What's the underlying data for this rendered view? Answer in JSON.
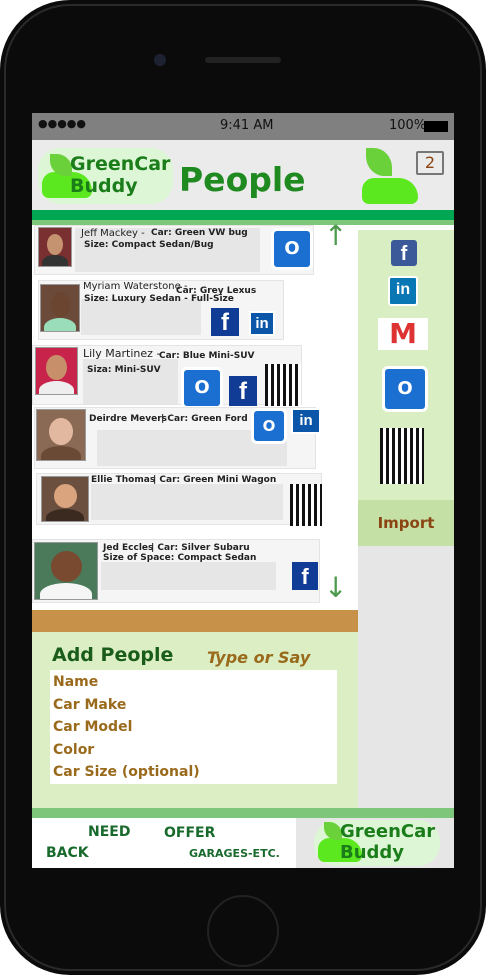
{
  "status_bar": {
    "signal": "●●●●●",
    "time": "9:41 AM",
    "battery": "100%"
  },
  "header": {
    "logo_line1": "GreenCar",
    "logo_line2": "Buddy",
    "title": "People",
    "notification_count": "2"
  },
  "people": [
    {
      "name": "Jeff Mackey -",
      "car": "Car: Green VW bug",
      "size": "Size: Compact Sedan/Bug",
      "icons": [
        "outlook"
      ]
    },
    {
      "name": "Myriam Waterstone -",
      "car": "Car: Grey Lexus",
      "size": "Size:  Luxury Sedan - Full-Size",
      "icons": [
        "facebook",
        "linkedin"
      ]
    },
    {
      "name": "Lily Martinez -",
      "car": "Car:  Blue Mini-SUV",
      "size": "Siza:  Mini-SUV",
      "icons": [
        "outlook",
        "facebook",
        "building"
      ]
    },
    {
      "name": "Deirdre Mevers",
      "car": "|  Car: Green Ford SUV",
      "size": "",
      "icons": [
        "outlook",
        "linkedin"
      ]
    },
    {
      "name": "Ellie Thomas",
      "car": "| Car: Green Mini Wagon",
      "size": "",
      "icons": [
        "building"
      ]
    },
    {
      "name": "Jed Eccles",
      "car": "|  Car: Silver Subaru",
      "size": "Size of Space: Compact Sedan",
      "icons": [
        "facebook"
      ]
    }
  ],
  "side_panel": {
    "icons": [
      "facebook",
      "linkedin",
      "gmail",
      "outlook",
      "building"
    ],
    "import_label": "Import"
  },
  "icon_glyphs": {
    "facebook": "f",
    "linkedin": "in",
    "outlook": "O",
    "gmail": "M"
  },
  "add_people": {
    "title": "Add People",
    "hint": "Type or Say",
    "fields": [
      "Name",
      "Car Make",
      "Car Model",
      "Color",
      "Car Size (optional)"
    ]
  },
  "bottom_nav": {
    "need": "NEED",
    "offer": "OFFER",
    "back": "BACK",
    "garages": "GARAGES-ETC.",
    "logo_line1": "GreenCar",
    "logo_line2": "Buddy"
  },
  "colors": {
    "brand_green": "#1f8a1f",
    "bar_green": "#00a651",
    "light_green": "#dcefc4",
    "brown": "#c8914a"
  }
}
